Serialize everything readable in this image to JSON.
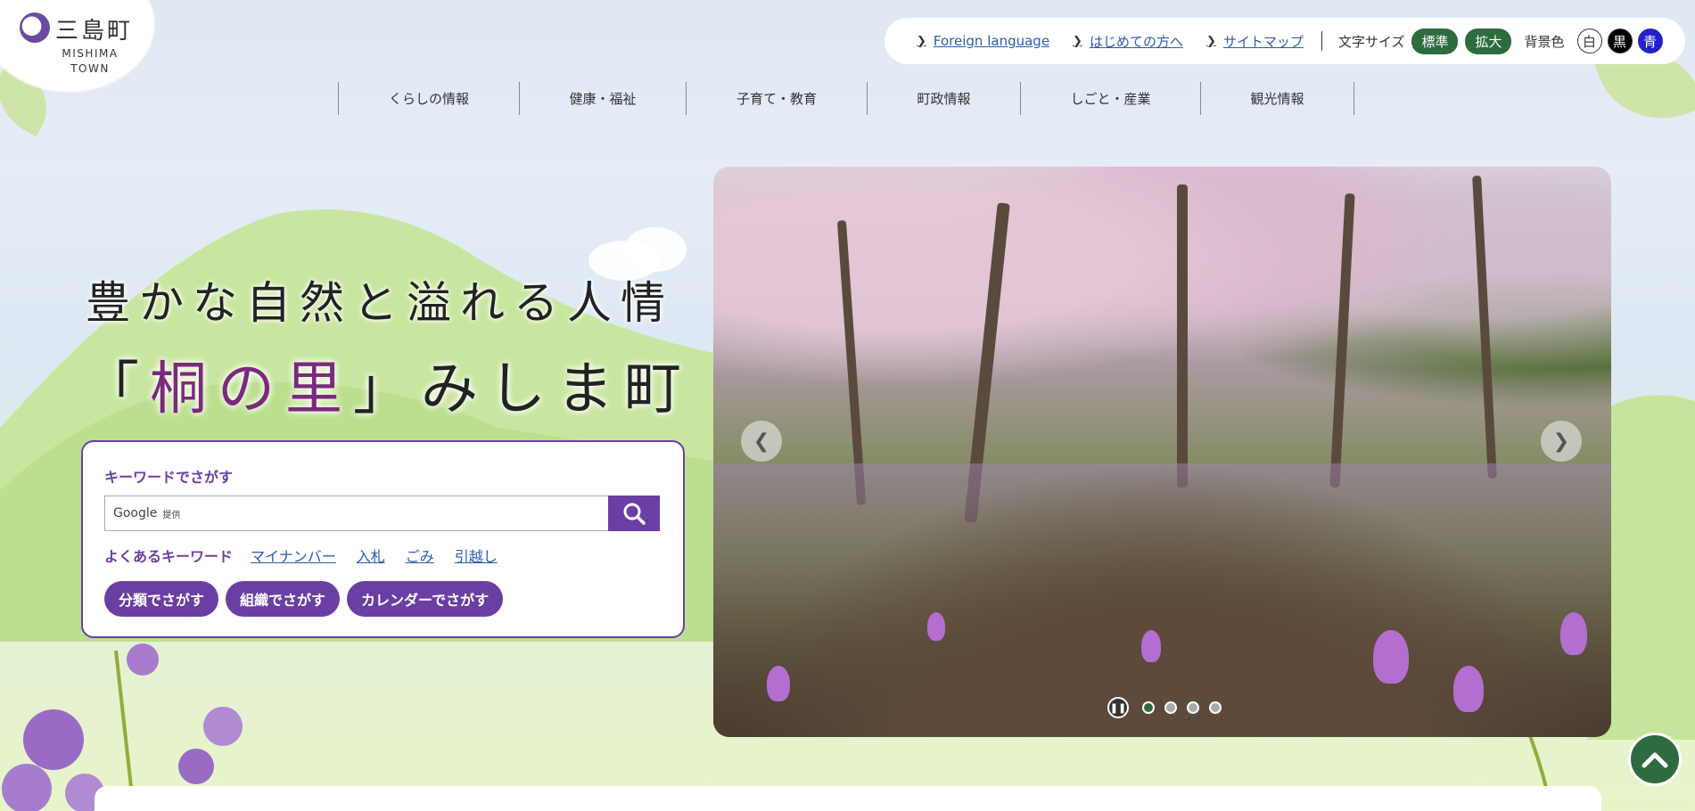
{
  "logo": {
    "name_jp": "三島町",
    "name_en_1": "MISHIMA",
    "name_en_2": "TOWN"
  },
  "utility": {
    "links": [
      "Foreign language",
      "はじめての方へ",
      "サイトマップ"
    ],
    "font_size_label": "文字サイズ",
    "font_size_options": [
      "標準",
      "拡大"
    ],
    "bg_color_label": "背景色",
    "bg_color_options": [
      {
        "label": "白",
        "bg": "#ffffff",
        "fg": "#333333"
      },
      {
        "label": "黒",
        "bg": "#000000",
        "fg": "#ffffff"
      },
      {
        "label": "青",
        "bg": "#2222c8",
        "fg": "#ffffff"
      }
    ]
  },
  "nav": [
    "くらしの情報",
    "健康・福祉",
    "子育て・教育",
    "町政情報",
    "しごと・産業",
    "観光情報"
  ],
  "hero": {
    "tagline": "豊かな自然と溢れる人情",
    "headline_open": "「",
    "headline_highlight": "桐の里",
    "headline_close": "」みしま町"
  },
  "search": {
    "title": "キーワードでさがす",
    "placeholder_brand": "Google",
    "placeholder_suffix": "提供",
    "keywords_label": "よくあるキーワード",
    "keywords": [
      "マイナンバー",
      "入札",
      "ごみ",
      "引越し"
    ],
    "buttons": [
      "分類でさがす",
      "組織でさがす",
      "カレンダーでさがす"
    ]
  },
  "slider": {
    "slide_count": 4,
    "current": 1
  },
  "colors": {
    "accent": "#6a3fa3",
    "green": "#2e6b3f",
    "link": "#2b5bb0"
  }
}
